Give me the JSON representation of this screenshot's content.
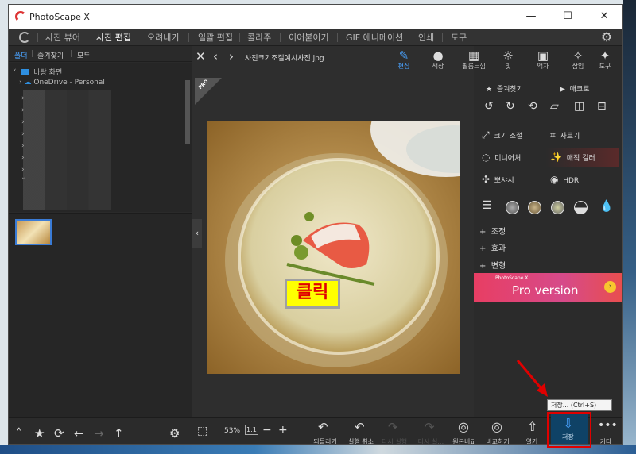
{
  "window": {
    "title": "PhotoScape X",
    "minimize": "—",
    "maximize": "☐",
    "close": "✕"
  },
  "menu": {
    "items": [
      "사진 뷰어",
      "사진 편집",
      "오려내기",
      "일괄 편집",
      "콜라주",
      "이어붙이기",
      "GIF 애니메이션",
      "인쇄",
      "도구"
    ],
    "active_index": 1
  },
  "left_tabs": [
    "폴더",
    "즐겨찾기",
    "모두"
  ],
  "tree": {
    "root": "바탕 화면",
    "onedrive": "OneDrive - Personal"
  },
  "editor": {
    "filename": "사진크기조절예시사진.jpg",
    "pro_badge": "PRO"
  },
  "toolbar": [
    {
      "icon": "edit-icon",
      "label": "편집"
    },
    {
      "icon": "color-icon",
      "label": "색상"
    },
    {
      "icon": "film-icon",
      "label": "필름느낌"
    },
    {
      "icon": "light-icon",
      "label": "빛"
    },
    {
      "icon": "frame-icon",
      "label": "액자"
    },
    {
      "icon": "insert-icon",
      "label": "삽입"
    },
    {
      "icon": "tools-icon",
      "label": "도구"
    }
  ],
  "right_panel": {
    "favorites": "즐겨찾기",
    "macro": "매크로",
    "resize": "크기 조절",
    "crop": "자르기",
    "miniature": "미니어처",
    "magic_color": "매직 컬러",
    "sharpen": "뽀샤시",
    "hdr": "HDR",
    "sections": [
      "조정",
      "효과",
      "변형"
    ]
  },
  "promo": {
    "brand": "PhotoScape X",
    "text": "Pro version",
    "arrow": "›"
  },
  "bottom_bar": {
    "zoom": "53%",
    "one_to_one": "1:1",
    "minus": "−",
    "plus": "+",
    "undo_all": "되돌리기",
    "undo": "실행 취소",
    "redo": "다시 실행",
    "redo_all": "다시 실…",
    "original": "원본비교",
    "compare": "비교하기",
    "open": "열기",
    "save": "저장",
    "more": "기타"
  },
  "tooltip": "저장... (Ctrl+S)",
  "callout": "클릭",
  "colors": {
    "accent": "#3a7bd5",
    "callout_bg": "#ffff00",
    "callout_text": "#e00000",
    "highlight": "#e00000"
  }
}
